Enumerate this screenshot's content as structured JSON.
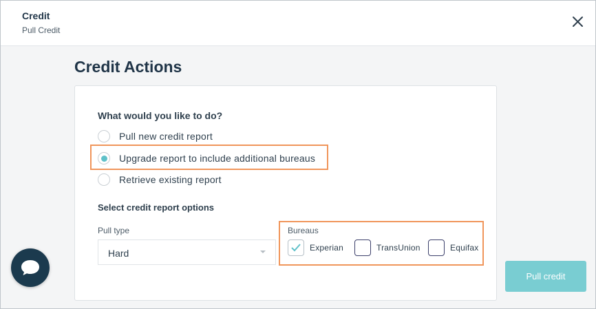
{
  "header": {
    "title": "Credit",
    "subtitle": "Pull Credit",
    "close_icon": "close-icon"
  },
  "main": {
    "section_title": "Credit Actions",
    "question": "What would you like to do?",
    "actions": [
      {
        "label": "Pull new credit report",
        "selected": false
      },
      {
        "label": "Upgrade report to include additional bureaus",
        "selected": true
      },
      {
        "label": "Retrieve existing report",
        "selected": false
      }
    ],
    "options_title": "Select credit report options",
    "pull_type": {
      "label": "Pull type",
      "value": "Hard",
      "icon": "chevron-down-icon"
    },
    "bureaus": {
      "label": "Bureaus",
      "items": [
        {
          "label": "Experian",
          "checked": true
        },
        {
          "label": "TransUnion",
          "checked": false
        },
        {
          "label": "Equifax",
          "checked": false
        }
      ]
    },
    "pull_button": "Pull credit"
  },
  "chat": {
    "icon": "chat-bubble-icon"
  },
  "colors": {
    "accent": "#5fc1c9",
    "button": "#79cdd2",
    "highlight": "#f0955a",
    "title": "#1f3447",
    "chat": "#1b3a4e"
  }
}
